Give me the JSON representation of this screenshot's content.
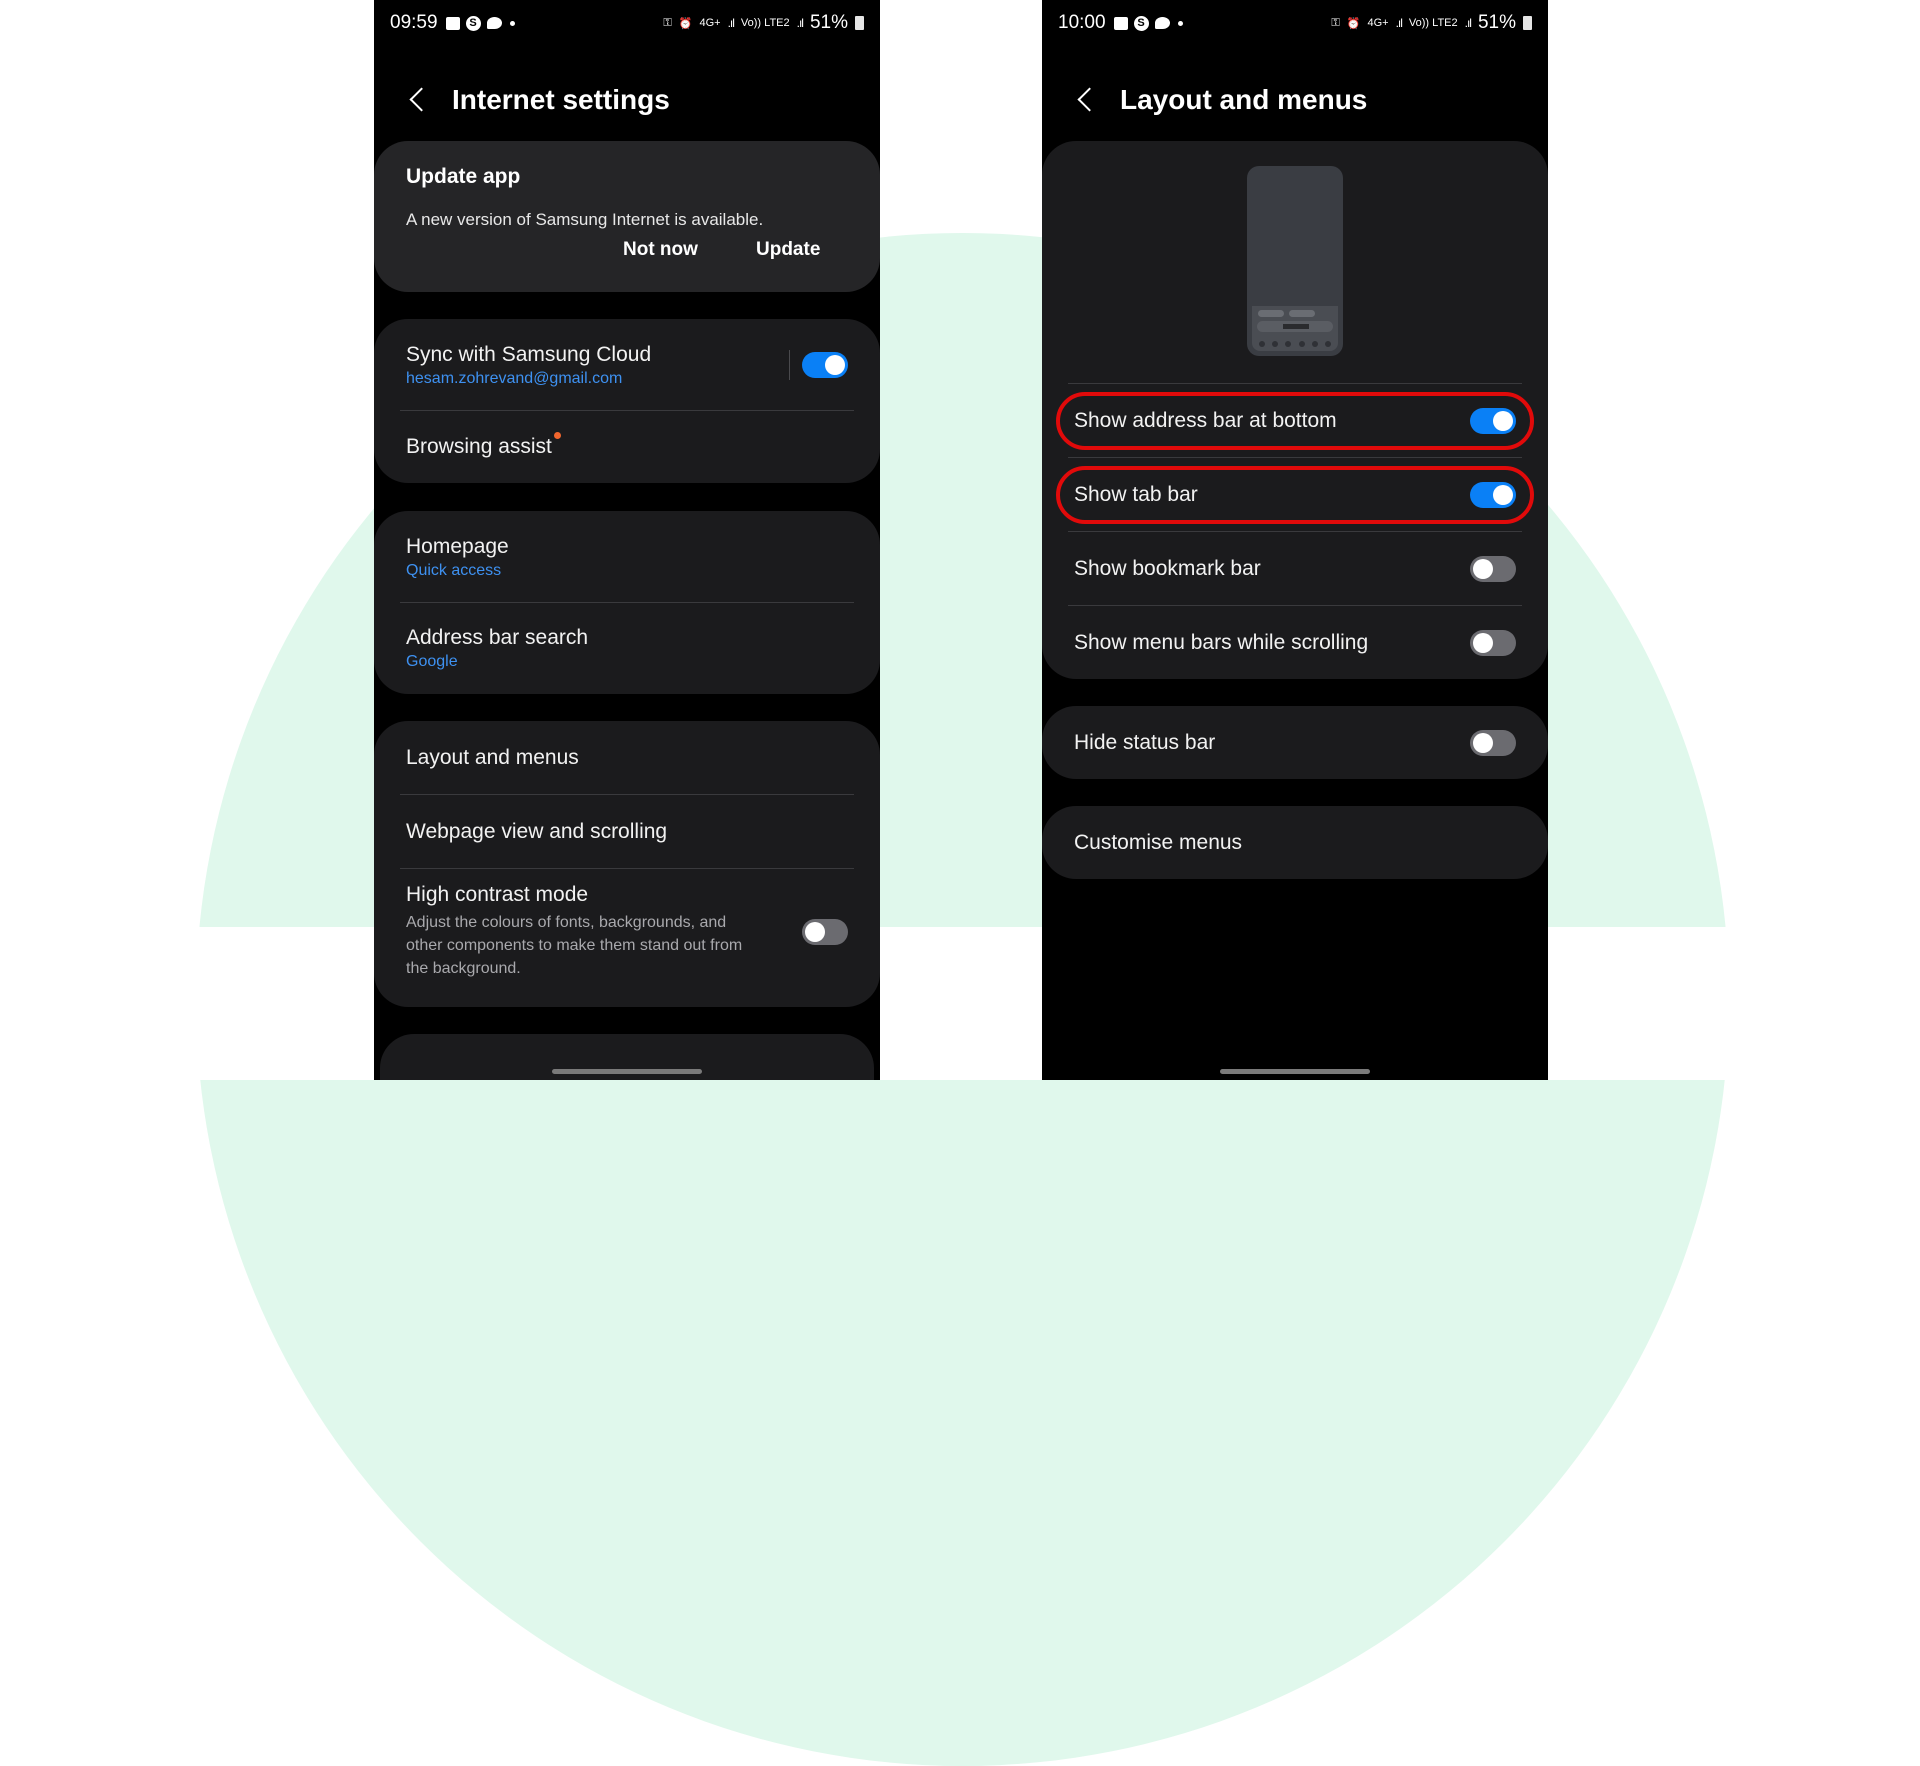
{
  "colors": {
    "accent_blue": "#0a80f6",
    "link_blue": "#3e91f1",
    "highlight_red": "#e10a0a",
    "badge_orange": "#f2662e",
    "bg_green": "#e0f8ec"
  },
  "left_screen": {
    "status_bar": {
      "time": "09:59",
      "left_icons": [
        "gallery-icon",
        "samsung-s-icon",
        "chat-icon",
        "dot-icon"
      ],
      "right_icons": [
        "vpn-key-icon",
        "alarm-icon",
        "4g-plus-icon",
        "signal-icon",
        "volte-lte2-icon",
        "signal-icon",
        "battery-icon"
      ],
      "network_1": "4G+",
      "network_2": "Vo)) LTE2",
      "battery": "51%"
    },
    "header": {
      "back_icon": "chevron-left-icon",
      "title": "Internet settings"
    },
    "update_card": {
      "title": "Update app",
      "message": "A new version of Samsung Internet is available.",
      "not_now_label": "Not now",
      "update_label": "Update"
    },
    "sync_group": {
      "sync": {
        "label": "Sync with Samsung Cloud",
        "account": "hesam.zohrevand@gmail.com",
        "enabled": true
      },
      "browsing_assist": {
        "label": "Browsing assist",
        "has_badge": true
      }
    },
    "home_group": {
      "homepage": {
        "label": "Homepage",
        "value": "Quick access"
      },
      "address_bar_search": {
        "label": "Address bar search",
        "value": "Google"
      }
    },
    "layout_group": {
      "layout_menus": {
        "label": "Layout and menus"
      },
      "webpage_view": {
        "label": "Webpage view and scrolling"
      },
      "high_contrast": {
        "label": "High contrast mode",
        "description": "Adjust the colours of fonts, backgrounds, and other components to make them stand out from the background.",
        "enabled": false
      }
    }
  },
  "right_screen": {
    "status_bar": {
      "time": "10:00",
      "network_1": "4G+",
      "network_2": "Vo)) LTE2",
      "battery": "51%"
    },
    "header": {
      "back_icon": "chevron-left-icon",
      "title": "Layout and menus"
    },
    "preview_illustration": "phone-layout-preview-icon",
    "toggles": [
      {
        "label": "Show address bar at bottom",
        "enabled": true,
        "highlighted": true
      },
      {
        "label": "Show tab bar",
        "enabled": true,
        "highlighted": true
      },
      {
        "label": "Show bookmark bar",
        "enabled": false,
        "highlighted": false
      },
      {
        "label": "Show menu bars while scrolling",
        "enabled": false,
        "highlighted": false
      }
    ],
    "hide_status_bar": {
      "label": "Hide status bar",
      "enabled": false
    },
    "customise_menus": {
      "label": "Customise menus"
    }
  }
}
